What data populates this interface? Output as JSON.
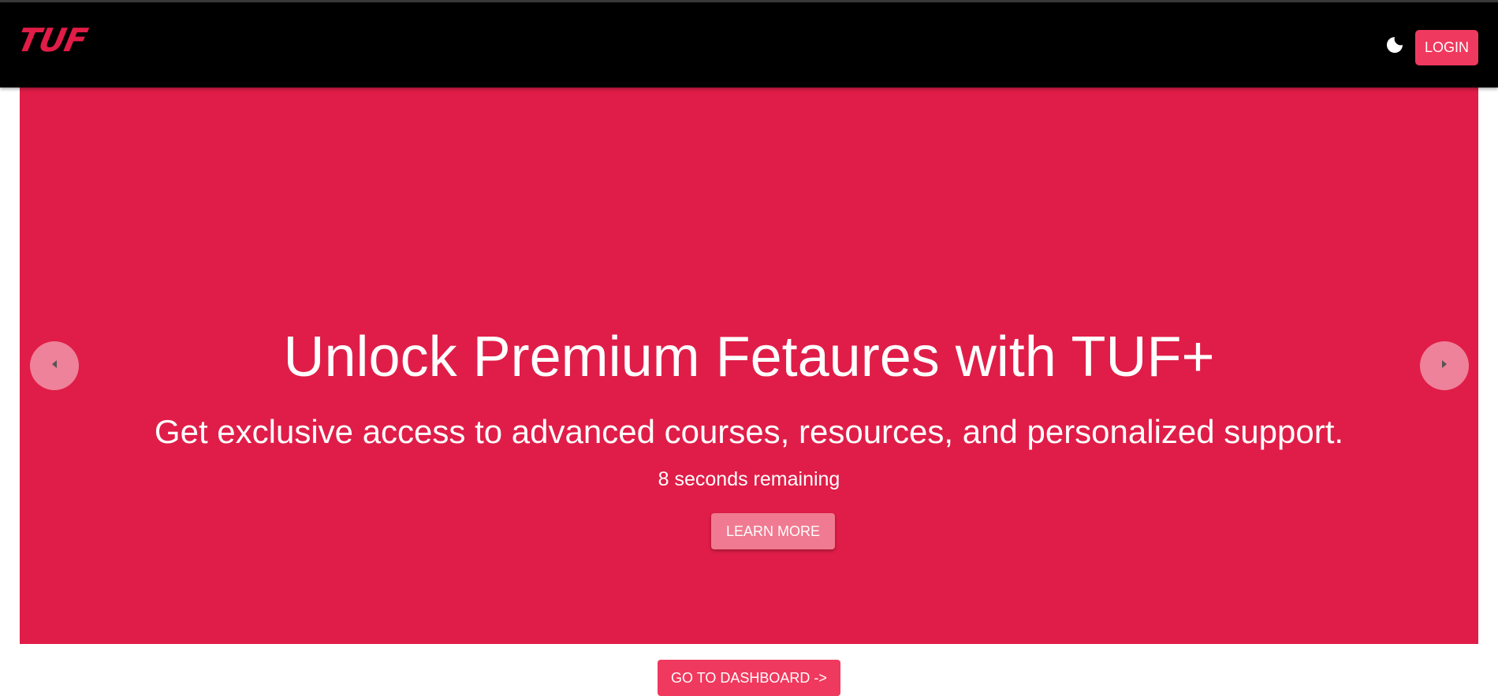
{
  "navbar": {
    "logo_text": "TUF",
    "theme_icon": "moon-icon",
    "login_label": "LOGIN"
  },
  "hero": {
    "title": "Unlock Premium Fetaures with TUF+",
    "subtitle": "Get exclusive access to advanced courses, resources, and personalized support.",
    "timer": "8 seconds remaining",
    "cta_label": "LEARN MORE",
    "prev_icon": "caret-left-icon",
    "next_icon": "caret-right-icon"
  },
  "footer": {
    "dashboard_label": "GO TO DASHBOARD ->"
  },
  "colors": {
    "brand": "#e01d48",
    "button": "#f0395e",
    "learn_more": "#f07a91",
    "navbar": "#000000"
  }
}
